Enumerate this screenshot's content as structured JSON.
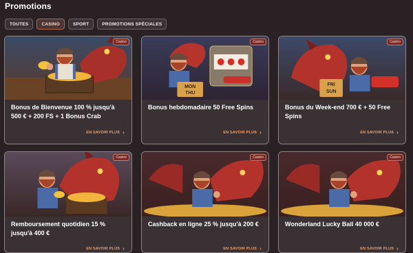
{
  "header": {
    "title": "Promotions"
  },
  "filters": [
    {
      "label": "TOUTES",
      "active": false
    },
    {
      "label": "CASINO",
      "active": true
    },
    {
      "label": "SPORT",
      "active": false
    },
    {
      "label": "PROMOTIONS SPÉCIALES",
      "active": false
    }
  ],
  "cards": [
    {
      "badge": "Casino",
      "title": "Bonus de Bienvenue 100 % jusqu'à 500 € + 200 FS + 1 Bonus Crab",
      "cta": "EN SAVOIR PLUS",
      "art": "miner-with-gold-dragon-background"
    },
    {
      "badge": "Casino",
      "title": "Bonus hebdomadaire 50 Free Spins",
      "cta": "EN SAVOIR PLUS",
      "art": "miner-at-slot-machine-with-dragon",
      "sign": "MON THU"
    },
    {
      "badge": "Casino",
      "title": "Bonus du Week-end 700 € + 50 Free Spins",
      "cta": "EN SAVOIR PLUS",
      "art": "dragon-and-miner-with-sign",
      "sign": "FRI SUN"
    },
    {
      "badge": "Casino",
      "title": "Remboursement quotidien 15 % jusqu'à 400 €",
      "cta": "EN SAVOIR PLUS",
      "art": "miner-with-gold-cart-and-dragon"
    },
    {
      "badge": "Casino",
      "title": "Cashback en ligne 25 % jusqu'à 200 €",
      "cta": "EN SAVOIR PLUS",
      "art": "miner-with-coins-and-dragon"
    },
    {
      "badge": "Casino",
      "title": "Wonderland Lucky Ball 40 000 €",
      "cta": "EN SAVOIR PLUS",
      "art": "miner-with-coins-and-dragon"
    }
  ],
  "colors": {
    "background": "#2a2125",
    "card": "#3a3134",
    "accent": "#f0a06a",
    "badge": "#7a2a26",
    "dragon": "#b0322c"
  }
}
